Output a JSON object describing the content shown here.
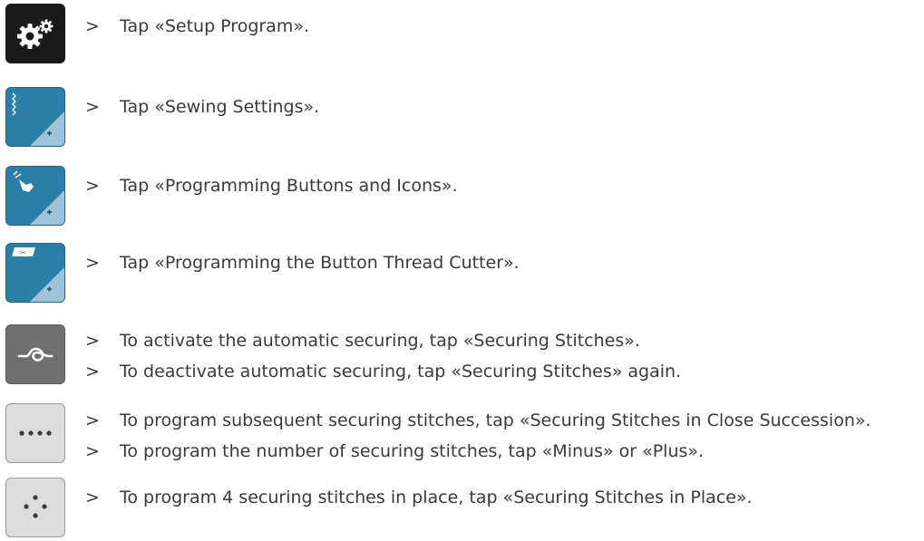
{
  "icons": {
    "setup_program": "gears-icon",
    "sewing_settings": "stitch-settings-icon",
    "programming_buttons": "tap-hand-icon",
    "thread_cutter": "scissors-button-icon",
    "securing_stitches": "knot-icon",
    "close_succession": "dots-row-icon",
    "in_place": "dots-cross-icon"
  },
  "colors": {
    "icon_blue": "#2b7ea6",
    "icon_dark": "#1a1a1a",
    "icon_gray": "#6f6f6f",
    "icon_light": "#dcdcdc"
  },
  "steps": [
    {
      "arrow": ">",
      "text": "Tap «Setup Program»."
    },
    {
      "arrow": ">",
      "text": "Tap «Sewing Settings»."
    },
    {
      "arrow": ">",
      "text": "Tap «Programming Buttons and Icons»."
    },
    {
      "arrow": ">",
      "text": "Tap «Programming the Button Thread Cutter»."
    },
    {
      "arrow": ">",
      "text": "To activate the automatic securing, tap «Securing Stitches»."
    },
    {
      "arrow": ">",
      "text": "To deactivate automatic securing, tap «Securing Stitches» again."
    },
    {
      "arrow": ">",
      "text": "To program subsequent securing stitches, tap «Securing Stitches in Close Succession»."
    },
    {
      "arrow": ">",
      "text": "To program the number of securing stitches, tap «Minus» or «Plus»."
    },
    {
      "arrow": ">",
      "text": "To program 4 securing stitches in place, tap «Securing Stitches in Place»."
    }
  ]
}
